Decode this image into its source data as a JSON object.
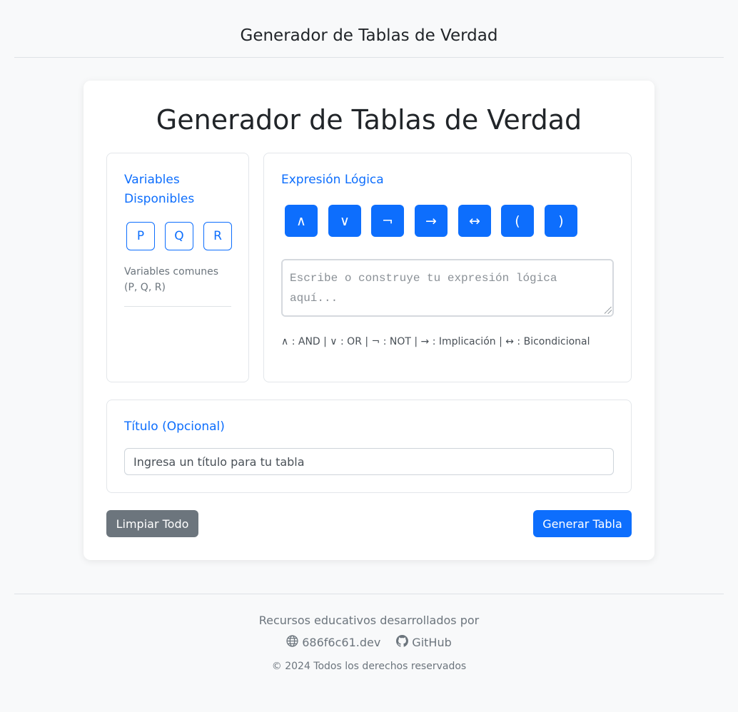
{
  "header": {
    "title": "Generador de Tablas de Verdad"
  },
  "main": {
    "title": "Generador de Tablas de Verdad",
    "variables": {
      "heading_line1": "Variables",
      "heading_line2": "Disponibles",
      "items": [
        "P",
        "Q",
        "R"
      ],
      "hint_line1": "Variables comunes",
      "hint_line2": "(P, Q, R)"
    },
    "expression": {
      "heading": "Expresión Lógica",
      "operators": [
        "∧",
        "∨",
        "¬",
        "→",
        "↔",
        "(",
        ")"
      ],
      "placeholder": "Escribe o construye tu expresión lógica aquí...",
      "legend": "∧ : AND | ∨ : OR | ¬ : NOT | → : Implicación | ↔ : Bicondicional"
    },
    "title_section": {
      "heading": "Título (Opcional)",
      "placeholder": "Ingresa un título para tu tabla"
    },
    "buttons": {
      "clear": "Limpiar Todo",
      "generate": "Generar Tabla"
    }
  },
  "footer": {
    "credit": "Recursos educativos desarrollados por",
    "site_link": "686f6c61.dev",
    "github_link": "GitHub",
    "copyright": "© 2024 Todos los derechos reservados"
  },
  "colors": {
    "accent": "#0d6efd",
    "secondary": "#6c757d",
    "background": "#f8f9fa"
  }
}
